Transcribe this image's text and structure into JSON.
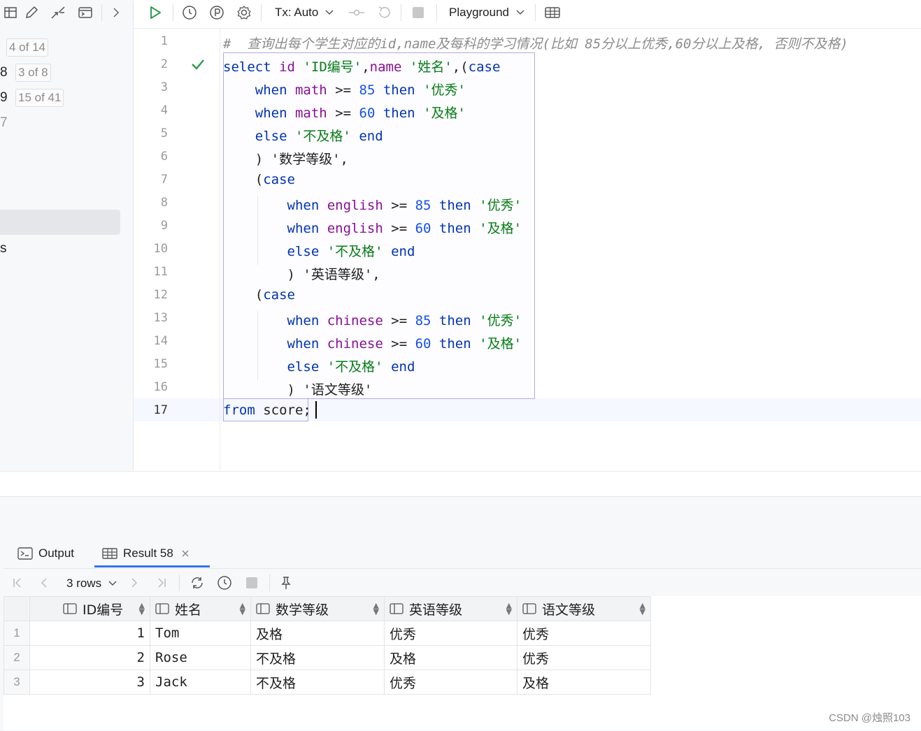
{
  "toolbar": {
    "tx_mode": "Tx: Auto",
    "playground": "Playground"
  },
  "left_panel": {
    "counters": [
      "4 of 14",
      "3 of 8",
      "15 of 41"
    ],
    "edge_chars": [
      "8",
      "9",
      "7",
      "s"
    ]
  },
  "editor": {
    "line_numbers": [
      "1",
      "2",
      "3",
      "4",
      "5",
      "6",
      "7",
      "8",
      "9",
      "10",
      "11",
      "12",
      "13",
      "14",
      "15",
      "16",
      "17"
    ],
    "current_line": "17",
    "comment": "#  查询出每个学生对应的id,name及每科的学习情况(比如 85分以上优秀,60分以上及格, 否则不及格)"
  },
  "results": {
    "tabs": {
      "output": "Output",
      "result": "Result 58"
    },
    "rows_label": "3 rows",
    "columns": [
      "ID编号",
      "姓名",
      "数学等级",
      "英语等级",
      "语文等级"
    ],
    "rows": [
      {
        "n": "1",
        "id": "1",
        "name": "Tom",
        "math": "及格",
        "english": "优秀",
        "chinese": "优秀"
      },
      {
        "n": "2",
        "id": "2",
        "name": "Rose",
        "math": "不及格",
        "english": "及格",
        "chinese": "优秀"
      },
      {
        "n": "3",
        "id": "3",
        "name": "Jack",
        "math": "不及格",
        "english": "优秀",
        "chinese": "及格"
      }
    ]
  },
  "watermark": "CSDN @烛照103",
  "colors": {
    "keyword": "#0033b3",
    "column": "#871094",
    "number": "#1750eb",
    "string": "#067d17",
    "accent": "#3574f0",
    "run": "#2e9e4f"
  }
}
